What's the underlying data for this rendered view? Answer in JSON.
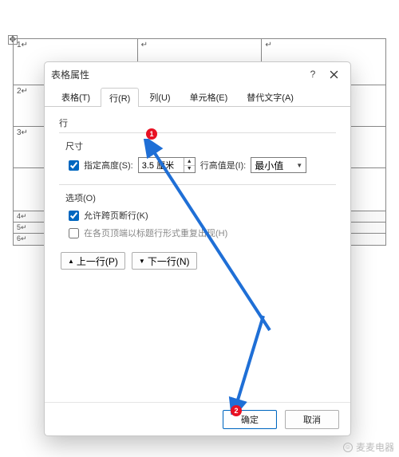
{
  "bg": {
    "r1": [
      "1↵",
      "↵",
      "↵"
    ],
    "r2": "2↵",
    "r3": "3↵",
    "rs": [
      "4↵",
      "5↵",
      "6↵"
    ]
  },
  "dialog": {
    "title": "表格属性",
    "help": "?",
    "tabs": [
      "表格(T)",
      "行(R)",
      "列(U)",
      "单元格(E)",
      "替代文字(A)"
    ],
    "active_tab": 1,
    "section": "行",
    "size": {
      "label": "尺寸",
      "specify_height_label": "指定高度(S):",
      "specify_height_checked": true,
      "height_value": "3.5 厘米",
      "height_is_label": "行高值是(I):",
      "height_is_value": "最小值"
    },
    "options": {
      "label": "选项(O)",
      "allow_break_label": "允许跨页断行(K)",
      "allow_break_checked": true,
      "repeat_header_label": "在各页顶端以标题行形式重复出现(H)",
      "repeat_header_checked": false
    },
    "nav": {
      "prev": "上一行(P)",
      "next": "下一行(N)"
    },
    "footer": {
      "ok": "确定",
      "cancel": "取消"
    }
  },
  "annotations": {
    "badge1": "1",
    "badge2": "2"
  },
  "watermark": {
    "text": "麦麦电器"
  }
}
